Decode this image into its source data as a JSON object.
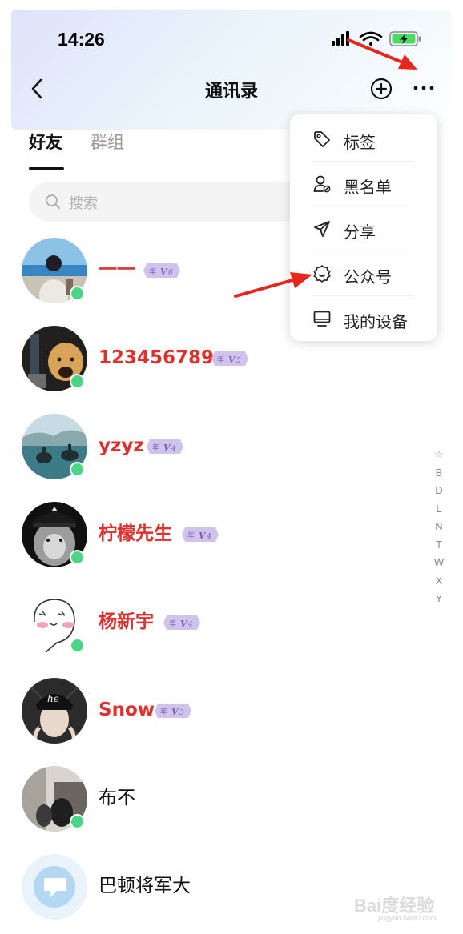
{
  "status_bar": {
    "time": "14:26"
  },
  "nav": {
    "title": "通讯录"
  },
  "tabs": [
    {
      "label": "好友",
      "active": true
    },
    {
      "label": "群组",
      "active": false
    }
  ],
  "search": {
    "placeholder": "搜索"
  },
  "contacts": [
    {
      "name": "一一",
      "level": "6",
      "vip": true,
      "online": true
    },
    {
      "name": "123456789",
      "level": "5",
      "vip": true,
      "online": true
    },
    {
      "name": "yzyz",
      "level": "4",
      "vip": true,
      "online": true
    },
    {
      "name": "柠檬先生",
      "level": "4",
      "vip": true,
      "online": true
    },
    {
      "name": "杨新宇",
      "level": "4",
      "vip": true,
      "online": true
    },
    {
      "name": "Snow",
      "level": "3",
      "vip": true,
      "online": false
    },
    {
      "name": "布不",
      "vip": false,
      "online": true
    },
    {
      "name": "巴顿将军大",
      "vip": false,
      "online": false
    }
  ],
  "badge_prefix": "年",
  "badge_letter": "V",
  "index_letters": [
    "☆",
    "B",
    "D",
    "L",
    "N",
    "T",
    "W",
    "X",
    "Y"
  ],
  "menu": {
    "items": [
      {
        "label": "标签",
        "icon": "tag-icon"
      },
      {
        "label": "黑名单",
        "icon": "user-block-icon"
      },
      {
        "label": "分享",
        "icon": "send-icon"
      },
      {
        "label": "公众号",
        "icon": "badge-verified-icon"
      },
      {
        "label": "我的设备",
        "icon": "monitor-icon"
      }
    ]
  },
  "colors": {
    "vip_name": "#e02f2c",
    "online_dot": "#4bd586",
    "arrow": "#e8261f",
    "badge_bg": "#cfc3ec",
    "badge_text": "#7c5fb5"
  },
  "watermark": {
    "text": "Bai度经验",
    "sub": "jingyan.baidu.com"
  }
}
